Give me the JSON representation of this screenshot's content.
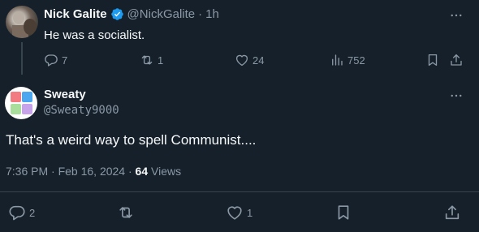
{
  "reply": {
    "display_name": "Nick Galite",
    "handle": "@NickGalite",
    "separator": "·",
    "time": "1h",
    "text": "He was a socialist.",
    "replies": "7",
    "reposts": "1",
    "likes": "24",
    "views": "752"
  },
  "main": {
    "display_name": "Sweaty",
    "handle": "@Sweaty9000",
    "text": "That's a weird way to spell Communist....",
    "timestamp": "7:36 PM · Feb 16, 2024 · ",
    "views_count": "64",
    "views_label": "Views",
    "replies": "2",
    "likes": "1"
  },
  "colors": {
    "background": "#15202b",
    "text": "#f7f9f9",
    "muted": "#8b98a5",
    "border": "#38444d",
    "verified": "#1d9bf0"
  }
}
